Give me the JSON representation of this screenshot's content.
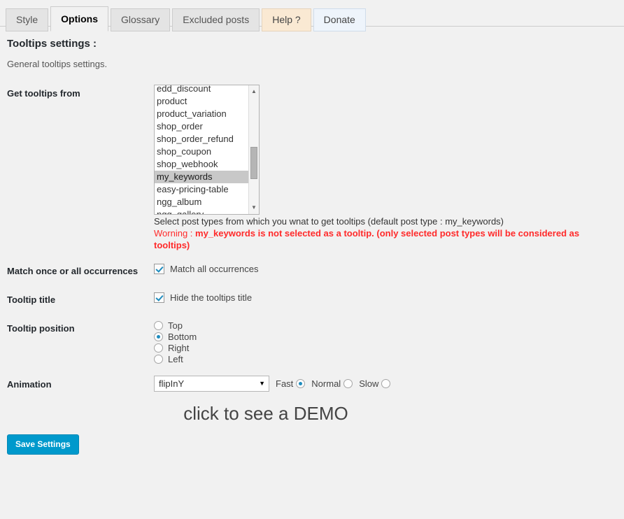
{
  "tabs": [
    {
      "label": "Style",
      "state": "normal"
    },
    {
      "label": "Options",
      "state": "active"
    },
    {
      "label": "Glossary",
      "state": "normal"
    },
    {
      "label": "Excluded posts",
      "state": "normal"
    },
    {
      "label": "Help ?",
      "state": "help"
    },
    {
      "label": "Donate",
      "state": "donate"
    }
  ],
  "header": {
    "title": "Tooltips settings :",
    "subtitle": "General tooltips settings."
  },
  "rows": {
    "get_tooltips_from": {
      "label": "Get tooltips from",
      "options": [
        "edd_discount",
        "product",
        "product_variation",
        "shop_order",
        "shop_order_refund",
        "shop_coupon",
        "shop_webhook",
        "my_keywords",
        "easy-pricing-table",
        "ngg_album",
        "ngg_gallery"
      ],
      "selected": "my_keywords",
      "note": "Select post types from which you wnat to get tooltips (default post type : my_keywords)",
      "warning_prefix": "Worning : ",
      "warning_bold": "my_keywords is not selected as a tooltip. (only selected post types will be considered as tooltips)",
      "scroll_up_icon": "scroll-up-arrow",
      "scroll_down_icon": "scroll-down-arrow"
    },
    "match_occurrences": {
      "label": "Match once or all occurrences",
      "checkbox_label": "Match all occurrences",
      "checked": true
    },
    "tooltip_title": {
      "label": "Tooltip title",
      "checkbox_label": "Hide the tooltips title",
      "checked": true
    },
    "tooltip_position": {
      "label": "Tooltip position",
      "options": [
        {
          "label": "Top",
          "checked": false
        },
        {
          "label": "Bottom",
          "checked": true
        },
        {
          "label": "Right",
          "checked": false
        },
        {
          "label": "Left",
          "checked": false
        }
      ]
    },
    "animation": {
      "label": "Animation",
      "selected": "flipInY",
      "caret_icon": "chevron-down-icon",
      "speeds": [
        {
          "label": "Fast",
          "checked": true
        },
        {
          "label": "Normal",
          "checked": false
        },
        {
          "label": "Slow",
          "checked": false
        }
      ],
      "demo_text": "click to see a DEMO"
    }
  },
  "footer": {
    "save_label": "Save Settings"
  },
  "colors": {
    "accent": "#0099cc",
    "warning": "#ff2a2a",
    "control": "#1e8cbe",
    "background": "#f1f1f1"
  }
}
